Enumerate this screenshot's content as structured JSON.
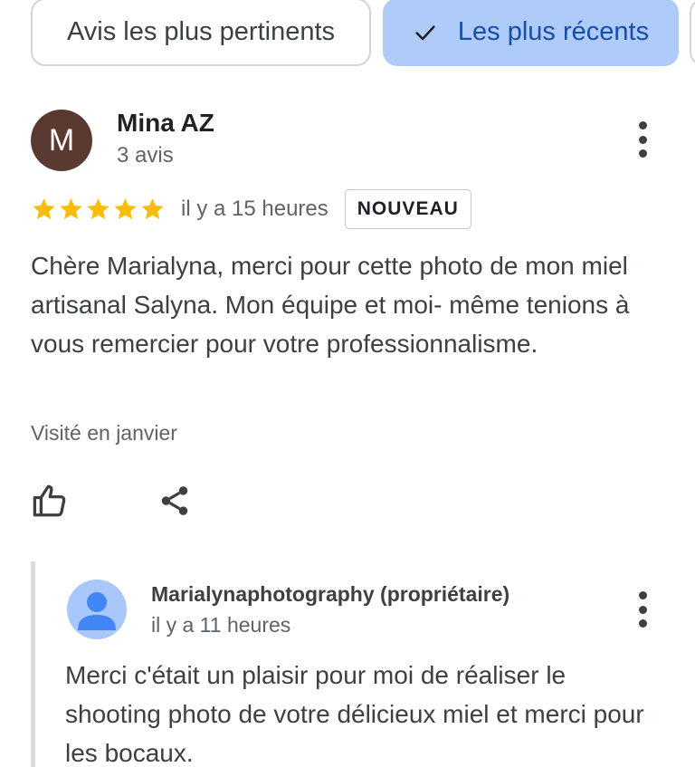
{
  "sort_chips": {
    "relevant_label": "Avis les plus pertinents",
    "recent_label": "Les plus récents",
    "selected": "recent"
  },
  "review": {
    "avatar_initial": "M",
    "author": "Mina AZ",
    "review_count": "3 avis",
    "rating": 5,
    "time": "il y a 15 heures",
    "badge": "NOUVEAU",
    "text": "Chère Marialyna, merci pour cette photo de mon miel artisanal Salyna. Mon équipe et moi- même tenions à vous remercier pour votre professionnalisme.",
    "visited": "Visité en janvier"
  },
  "owner_reply": {
    "author": "Marialynaphotography (propriétaire)",
    "time": "il y a 11 heures",
    "text": "Merci c'était un plaisir pour moi de réaliser le shooting photo de votre délicieux miel et merci pour les bocaux."
  },
  "icons": {
    "check": "check-icon",
    "more": "more-vert-icon",
    "star": "star-icon",
    "like": "thumbs-up-icon",
    "share": "share-icon",
    "person": "person-icon"
  },
  "colors": {
    "selected_chip_bg": "#aecbfa",
    "selected_chip_text": "#174ea6",
    "star": "#fbbc04",
    "avatar_m": "#5a3a30",
    "owner_avatar_bg": "#a8c7fa",
    "owner_avatar_fg": "#4285f4"
  }
}
